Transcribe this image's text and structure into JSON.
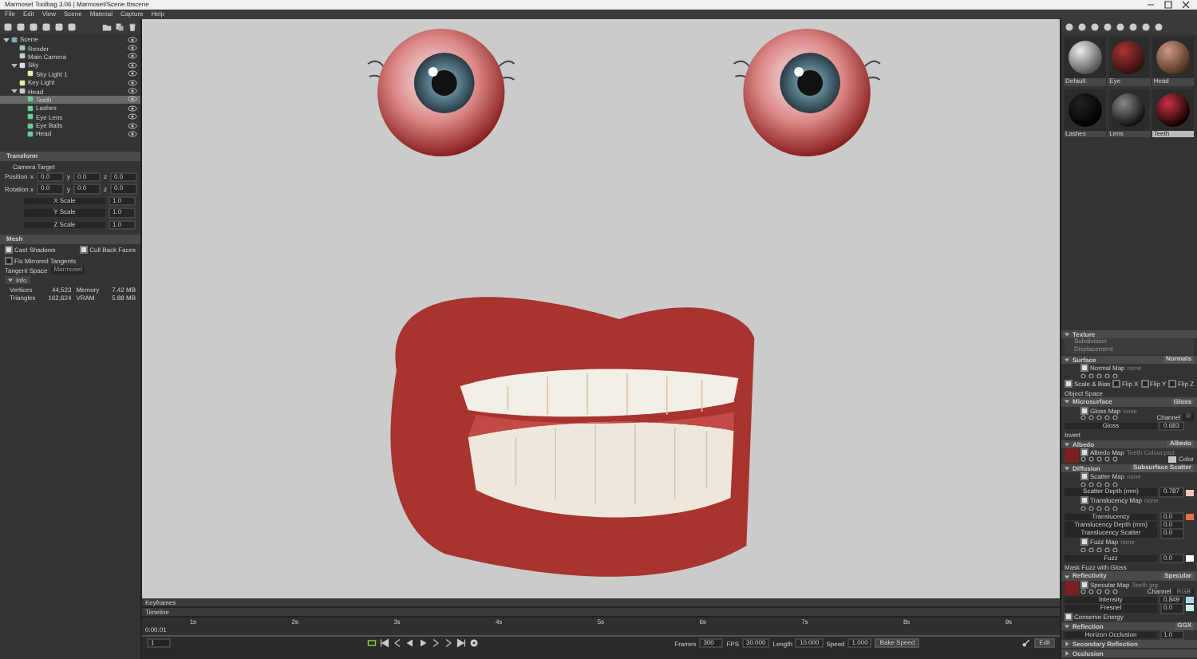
{
  "window": {
    "title": "Marmoset Toolbag 3.06 | Marmoset/Scene.tbscene"
  },
  "menu": [
    "File",
    "Edit",
    "View",
    "Scene",
    "Material",
    "Capture",
    "Help"
  ],
  "scene_tree": [
    {
      "label": "Scene",
      "kind": "scene",
      "expanded": true,
      "selected": false,
      "visible": true,
      "children": [
        {
          "label": "Render",
          "kind": "render",
          "expanded": false,
          "selected": false,
          "visible": true
        },
        {
          "label": "Main Camera",
          "kind": "camera",
          "expanded": false,
          "selected": false,
          "visible": true
        },
        {
          "label": "Sky",
          "kind": "sky",
          "expanded": true,
          "selected": false,
          "visible": true,
          "children": [
            {
              "label": "Sky Light 1",
              "kind": "light",
              "expanded": false,
              "selected": false,
              "visible": true
            }
          ]
        },
        {
          "label": "Key Light",
          "kind": "light",
          "expanded": false,
          "selected": false,
          "visible": true
        },
        {
          "label": "Head",
          "kind": "object",
          "expanded": true,
          "selected": false,
          "visible": true,
          "children": [
            {
              "label": "Teeth",
              "kind": "mesh",
              "expanded": false,
              "selected": true,
              "visible": true
            },
            {
              "label": "Lashes",
              "kind": "mesh",
              "expanded": false,
              "selected": false,
              "visible": true
            },
            {
              "label": "Eye Lens",
              "kind": "mesh",
              "expanded": false,
              "selected": false,
              "visible": true
            },
            {
              "label": "Eye Balls",
              "kind": "mesh",
              "expanded": false,
              "selected": false,
              "visible": true
            },
            {
              "label": "Head",
              "kind": "mesh",
              "expanded": false,
              "selected": false,
              "visible": true
            }
          ]
        }
      ]
    }
  ],
  "transform": {
    "title": "Transform",
    "target": "Camera Target",
    "position": {
      "label": "Position",
      "values": [
        {
          "axis": "x",
          "value": "0.0"
        },
        {
          "axis": "y",
          "value": "0.0"
        },
        {
          "axis": "z",
          "value": "0.0"
        }
      ]
    },
    "rotation": {
      "label": "Rotation",
      "values": [
        {
          "axis": "x",
          "value": "0.0"
        },
        {
          "axis": "y",
          "value": "0.0"
        },
        {
          "axis": "z",
          "value": "0.0"
        }
      ]
    },
    "scales": [
      {
        "label": "X Scale",
        "value": "1.0"
      },
      {
        "label": "Y Scale",
        "value": "1.0"
      },
      {
        "label": "Z Scale",
        "value": "1.0"
      }
    ]
  },
  "mesh": {
    "title": "Mesh",
    "options": [
      {
        "label": "Cast Shadows",
        "checked": true
      },
      {
        "label": "Cull Back Faces",
        "checked": true
      },
      {
        "label": "Fix Mirrored Tangents",
        "checked": false
      }
    ],
    "tangent_space": {
      "label": "Tangent Space",
      "value": "Marmoset"
    },
    "info": {
      "title": "Info",
      "expanded": true,
      "stats": [
        {
          "label": "Vertices",
          "value": "44,523"
        },
        {
          "label": "Memory",
          "value": "7.42 MB"
        },
        {
          "label": "Triangles",
          "value": "162,624"
        },
        {
          "label": "VRAM",
          "value": "5.88 MB"
        }
      ]
    }
  },
  "materials": [
    {
      "name": "Default",
      "kind": "chrome",
      "selected": false
    },
    {
      "name": "Eye",
      "kind": "eye",
      "selected": false
    },
    {
      "name": "Head",
      "kind": "skin",
      "selected": false
    },
    {
      "name": "Lashes",
      "kind": "black",
      "selected": false
    },
    {
      "name": "Lens",
      "kind": "glass",
      "selected": false
    },
    {
      "name": "Teeth",
      "kind": "teeth",
      "selected": true
    }
  ],
  "material_sections": [
    {
      "title": "Texture",
      "expanded": true,
      "rows": [
        {
          "kind": "subsection",
          "label": "Subdivision"
        },
        {
          "kind": "subsection",
          "label": "Displacement"
        }
      ]
    },
    {
      "title": "Surface",
      "mode": "Normals",
      "expanded": true,
      "rows": [
        {
          "kind": "map",
          "label": "Normal Map",
          "file": "none",
          "checked": true
        },
        {
          "kind": "flips",
          "items": [
            {
              "label": "Scale & Bias",
              "checked": true
            },
            {
              "label": "Flip X",
              "checked": false
            },
            {
              "label": "Flip Y",
              "checked": false
            },
            {
              "label": "Flip Z",
              "checked": false
            }
          ]
        },
        {
          "kind": "text",
          "label": "Object Space"
        }
      ]
    },
    {
      "title": "Microsurface",
      "mode": "Gloss",
      "expanded": true,
      "rows": [
        {
          "kind": "map",
          "label": "Gloss Map",
          "file": "none",
          "checked": true,
          "channel_label": "Channel",
          "channel": "R"
        },
        {
          "kind": "field",
          "label": "Gloss",
          "value": "0.683"
        },
        {
          "kind": "text",
          "label": "Invert"
        }
      ]
    },
    {
      "title": "Albedo",
      "mode": "Albedo",
      "expanded": true,
      "rows": [
        {
          "kind": "map",
          "label": "Albedo Map",
          "file": "Teeth Colour.psd",
          "checked": true,
          "thumbnail": true,
          "color": "#c8c8c8",
          "swatch_label": "Color"
        }
      ]
    },
    {
      "title": "Diffusion",
      "mode": "Subsurface Scatter",
      "expanded": true,
      "rows": [
        {
          "kind": "map",
          "label": "Scatter Map",
          "file": "none",
          "checked": true
        },
        {
          "kind": "field",
          "label": "Scatter Depth (mm)",
          "value": "0.787",
          "color": "#f4c8bc"
        },
        {
          "kind": "map",
          "label": "Translucency Map",
          "file": "none",
          "checked": true
        },
        {
          "kind": "field",
          "label": "Translucency",
          "value": "0.0",
          "color": "#e8704a"
        },
        {
          "kind": "field",
          "label": "Translucency Depth (mm)",
          "value": "0.0"
        },
        {
          "kind": "field",
          "label": "Translucency Scatter",
          "value": "0.0"
        },
        {
          "kind": "map",
          "label": "Fuzz Map",
          "file": "none",
          "checked": true
        },
        {
          "kind": "field",
          "label": "Fuzz",
          "value": "0.0",
          "color": "#ffffff"
        },
        {
          "kind": "text",
          "label": "Mask Fuzz with Gloss"
        }
      ]
    },
    {
      "title": "Reflectivity",
      "mode": "Specular",
      "expanded": true,
      "rows": [
        {
          "kind": "map",
          "label": "Specular Map",
          "file": "Teeth.jpg",
          "checked": true,
          "thumbnail": true,
          "channel_label": "Channel",
          "channel": "RGB"
        },
        {
          "kind": "field",
          "label": "Intensity",
          "value": "0.849",
          "color": "#a8dcec"
        },
        {
          "kind": "field",
          "label": "Fresnel",
          "value": "0.0",
          "color": "#c8f0f4"
        },
        {
          "kind": "check",
          "label": "Conserve Energy",
          "checked": true
        }
      ]
    },
    {
      "title": "Reflection",
      "mode": "GGX",
      "expanded": true,
      "rows": [
        {
          "kind": "field",
          "label": "Horizon Occlusion",
          "value": "1.0"
        }
      ]
    },
    {
      "title": "Secondary Reflection",
      "expanded": false
    },
    {
      "title": "Occlusion",
      "expanded": false
    }
  ],
  "timeline": {
    "keyframes_label": "Keyframes",
    "timeline_label": "Timeline",
    "ticks": [
      "1s",
      "2s",
      "3s",
      "4s",
      "5s",
      "6s",
      "7s",
      "8s",
      "9s"
    ],
    "current_time": "0:00.01",
    "frame_field": "1",
    "settings": [
      {
        "label": "Frames",
        "value": "300"
      },
      {
        "label": "FPS",
        "value": "30.000"
      },
      {
        "label": "Length",
        "value": "10.000"
      },
      {
        "label": "Speed",
        "value": "1.000"
      }
    ],
    "bake_button": "Bake Speed",
    "edit_button": "Edit"
  }
}
